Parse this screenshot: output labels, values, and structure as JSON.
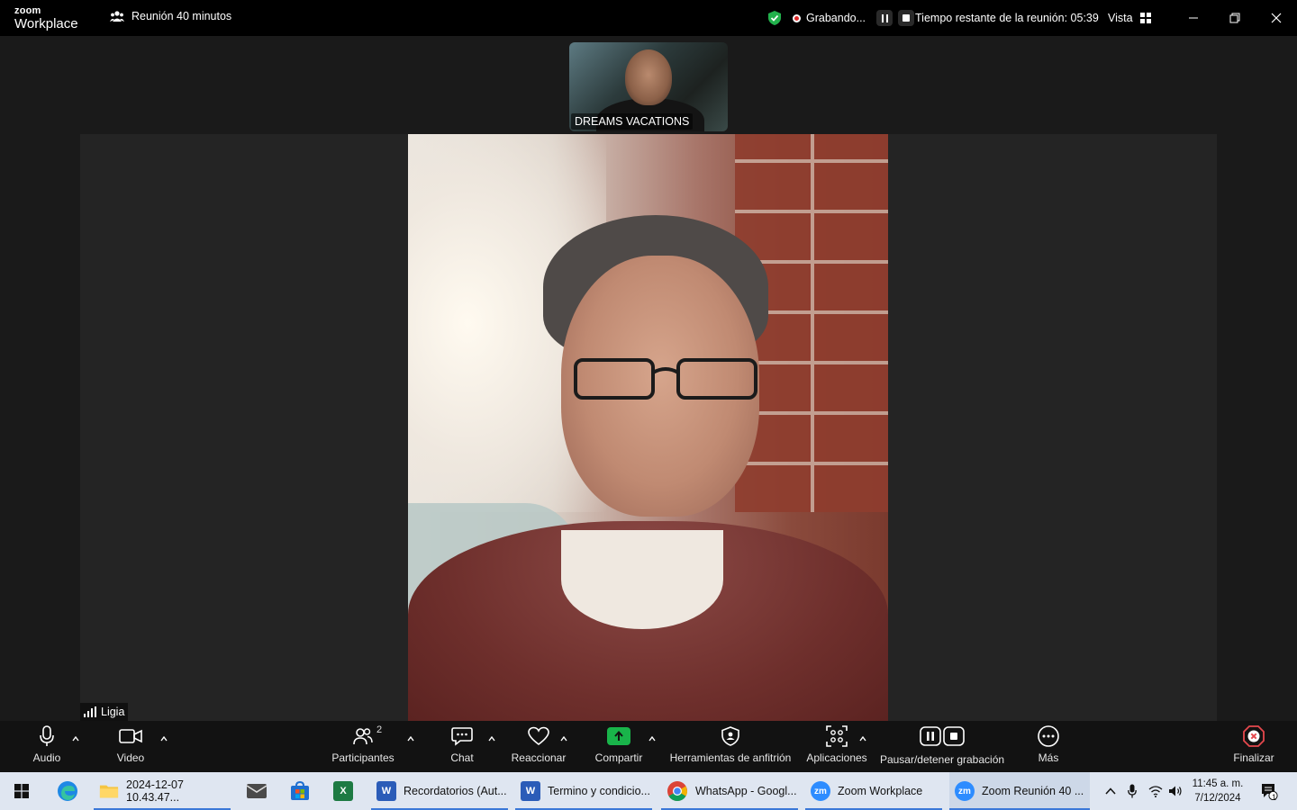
{
  "app": {
    "brand_top": "zoom",
    "brand_bottom": "Workplace"
  },
  "titlebar": {
    "meeting_topic": "Reunión 40 minutos",
    "recording_label": "Grabando...",
    "time_remaining": "Tiempo restante de la reunión: 05:39",
    "view_label": "Vista"
  },
  "participants_video": {
    "thumbnail_name": "DREAMS VACATIONS",
    "active_speaker_name": "Ligia"
  },
  "controls": {
    "audio": "Audio",
    "video": "Video",
    "participants": "Participantes",
    "participants_count": "2",
    "chat": "Chat",
    "react": "Reaccionar",
    "share": "Compartir",
    "host_tools": "Herramientas de anfitrión",
    "apps": "Aplicaciones",
    "recording": "Pausar/detener grabación",
    "more": "Más",
    "end": "Finalizar"
  },
  "taskbar": {
    "items": [
      {
        "label": "2024-12-07 10.43.47..."
      },
      {
        "label": "Recordatorios (Aut..."
      },
      {
        "label": "Termino y condicio..."
      },
      {
        "label": "WhatsApp - Googl..."
      },
      {
        "label": "Zoom Workplace"
      },
      {
        "label": "Zoom Reunión 40 ..."
      }
    ],
    "time": "11:45 a. m.",
    "date": "7/12/2024",
    "notification_count": "1"
  },
  "colors": {
    "accent_green": "#19b44a",
    "record_red": "#e02828",
    "end_red": "#e5484d",
    "taskbar_active": "#3b78d8"
  }
}
